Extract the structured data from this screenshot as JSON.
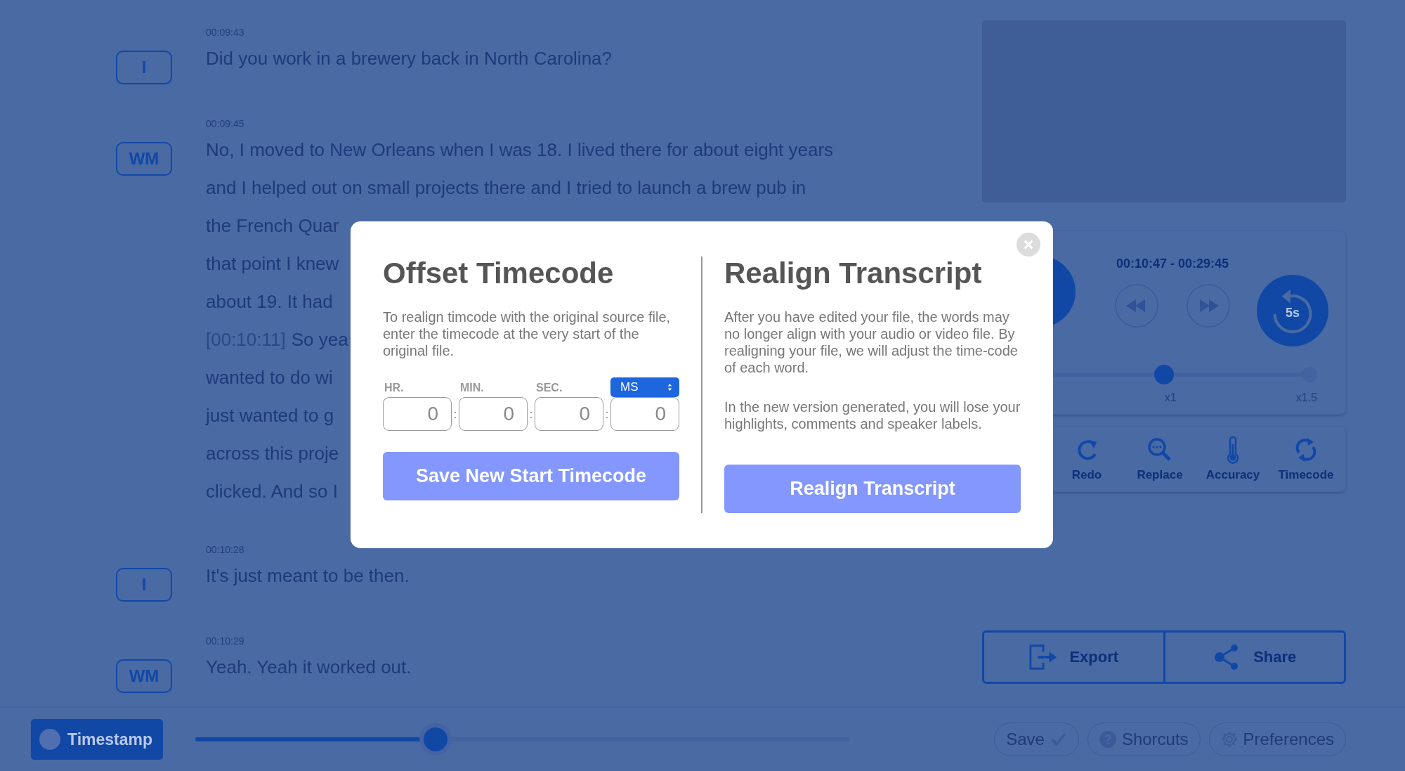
{
  "transcript": [
    {
      "speaker": "I",
      "time": "00:09:43",
      "lines": [
        {
          "text": "Did you work in a brewery back in North Carolina?"
        }
      ]
    },
    {
      "speaker": "WM",
      "time": "00:09:45",
      "lines": [
        {
          "text": "No, I moved to New Orleans when I was 18. I lived there for about eight years"
        },
        {
          "text": "and I helped out on small projects there and I tried to launch a brew pub in"
        },
        {
          "text": "the French Quar"
        },
        {
          "text": "that point I knew"
        },
        {
          "text": "about 19. It had"
        },
        {
          "timestamp": "[00:10:11]",
          "text": "So yea"
        },
        {
          "text": "wanted to do wi"
        },
        {
          "text": "just wanted to g"
        },
        {
          "text": "across this proje"
        },
        {
          "text": "clicked. And so I"
        }
      ]
    },
    {
      "speaker": "I",
      "time": "00:10:28",
      "lines": [
        {
          "text": "It's just meant to be then."
        }
      ]
    },
    {
      "speaker": "WM",
      "time": "00:10:29",
      "lines": [
        {
          "text": " Yeah. Yeah it worked out."
        }
      ]
    }
  ],
  "player": {
    "time_range": "00:10:47 - 00:29:45",
    "skip_label": "5s",
    "speed": {
      "level": 0.5,
      "labels": [
        "x1",
        "x1.5"
      ]
    }
  },
  "tools": [
    {
      "kind": "redo",
      "label": "Redo"
    },
    {
      "kind": "replace",
      "label": "Replace"
    },
    {
      "kind": "accuracy",
      "label": "Accuracy"
    },
    {
      "kind": "timecode",
      "label": "Timecode"
    }
  ],
  "actions": [
    {
      "kind": "export",
      "label": "Export"
    },
    {
      "kind": "share",
      "label": "Share"
    }
  ],
  "bottom_bar": {
    "timestamp_button": "Timestamp",
    "scrubber": {
      "level": 0.367
    },
    "buttons": [
      {
        "kind": "save",
        "label": "Save"
      },
      {
        "kind": "help",
        "label": "Shorcuts"
      },
      {
        "kind": "gear",
        "label": "Preferences"
      }
    ]
  },
  "modal": {
    "offset": {
      "title": "Offset Timecode",
      "description": "To realign timcode with the original source file, enter the timecode at the very start of the original file.",
      "fields": [
        {
          "kind": "label",
          "label": "HR.",
          "value": "0"
        },
        {
          "kind": "label",
          "label": "MIN.",
          "value": "0"
        },
        {
          "kind": "label",
          "label": "SEC.",
          "value": "0"
        },
        {
          "kind": "select",
          "label": "MS",
          "value": "0"
        }
      ],
      "separator": ":",
      "button": "Save New Start Timecode"
    },
    "realign": {
      "title": "Realign Transcript",
      "paragraphs": [
        "After you have edited your file, the words may no longer align with your audio or video file. By realigning your file, we will adjust the time-code of each word.",
        "In the new version generated, you will lose your highlights, comments and speaker labels."
      ],
      "button": "Realign Transcript"
    }
  }
}
